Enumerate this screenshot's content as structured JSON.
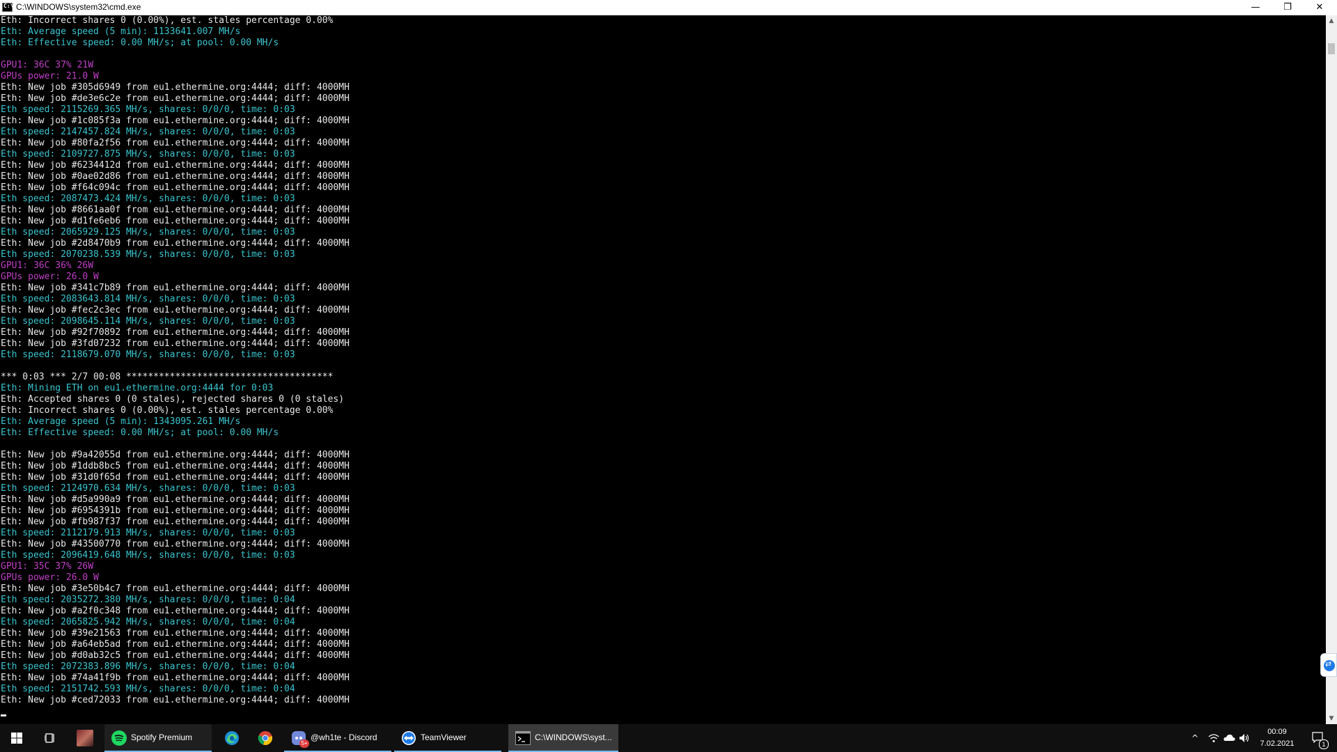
{
  "window": {
    "title": "C:\\WINDOWS\\system32\\cmd.exe",
    "minimize": "—",
    "restore": "❐",
    "close": "✕"
  },
  "colors": {
    "white": "#e8e8e8",
    "cyan": "#39c5cf",
    "magenta": "#c13fc8"
  },
  "console_lines": [
    {
      "text": "Eth: Incorrect shares 0 (0.00%), est. stales percentage 0.00%",
      "color": "white"
    },
    {
      "text": "Eth: Average speed (5 min): 1133641.007 MH/s",
      "color": "cyan"
    },
    {
      "text": "Eth: Effective speed: 0.00 MH/s; at pool: 0.00 MH/s",
      "color": "cyan"
    },
    {
      "text": "",
      "color": "white"
    },
    {
      "text": "GPU1: 36C 37% 21W",
      "color": "magenta"
    },
    {
      "text": "GPUs power: 21.0 W",
      "color": "magenta"
    },
    {
      "text": "Eth: New job #305d6949 from eu1.ethermine.org:4444; diff: 4000MH",
      "color": "white"
    },
    {
      "text": "Eth: New job #de3e6c2e from eu1.ethermine.org:4444; diff: 4000MH",
      "color": "white"
    },
    {
      "text": "Eth speed: 2115269.365 MH/s, shares: 0/0/0, time: 0:03",
      "color": "cyan"
    },
    {
      "text": "Eth: New job #1c085f3a from eu1.ethermine.org:4444; diff: 4000MH",
      "color": "white"
    },
    {
      "text": "Eth speed: 2147457.824 MH/s, shares: 0/0/0, time: 0:03",
      "color": "cyan"
    },
    {
      "text": "Eth: New job #80fa2f56 from eu1.ethermine.org:4444; diff: 4000MH",
      "color": "white"
    },
    {
      "text": "Eth speed: 2109727.875 MH/s, shares: 0/0/0, time: 0:03",
      "color": "cyan"
    },
    {
      "text": "Eth: New job #6234412d from eu1.ethermine.org:4444; diff: 4000MH",
      "color": "white"
    },
    {
      "text": "Eth: New job #0ae02d86 from eu1.ethermine.org:4444; diff: 4000MH",
      "color": "white"
    },
    {
      "text": "Eth: New job #f64c094c from eu1.ethermine.org:4444; diff: 4000MH",
      "color": "white"
    },
    {
      "text": "Eth speed: 2087473.424 MH/s, shares: 0/0/0, time: 0:03",
      "color": "cyan"
    },
    {
      "text": "Eth: New job #8661aa0f from eu1.ethermine.org:4444; diff: 4000MH",
      "color": "white"
    },
    {
      "text": "Eth: New job #d1fe6eb6 from eu1.ethermine.org:4444; diff: 4000MH",
      "color": "white"
    },
    {
      "text": "Eth speed: 2065929.125 MH/s, shares: 0/0/0, time: 0:03",
      "color": "cyan"
    },
    {
      "text": "Eth: New job #2d8470b9 from eu1.ethermine.org:4444; diff: 4000MH",
      "color": "white"
    },
    {
      "text": "Eth speed: 2070238.539 MH/s, shares: 0/0/0, time: 0:03",
      "color": "cyan"
    },
    {
      "text": "GPU1: 36C 36% 26W",
      "color": "magenta"
    },
    {
      "text": "GPUs power: 26.0 W",
      "color": "magenta"
    },
    {
      "text": "Eth: New job #341c7b89 from eu1.ethermine.org:4444; diff: 4000MH",
      "color": "white"
    },
    {
      "text": "Eth speed: 2083643.814 MH/s, shares: 0/0/0, time: 0:03",
      "color": "cyan"
    },
    {
      "text": "Eth: New job #fec2c3ec from eu1.ethermine.org:4444; diff: 4000MH",
      "color": "white"
    },
    {
      "text": "Eth speed: 2098645.114 MH/s, shares: 0/0/0, time: 0:03",
      "color": "cyan"
    },
    {
      "text": "Eth: New job #92f70892 from eu1.ethermine.org:4444; diff: 4000MH",
      "color": "white"
    },
    {
      "text": "Eth: New job #3fd07232 from eu1.ethermine.org:4444; diff: 4000MH",
      "color": "white"
    },
    {
      "text": "Eth speed: 2118679.070 MH/s, shares: 0/0/0, time: 0:03",
      "color": "cyan"
    },
    {
      "text": "",
      "color": "white"
    },
    {
      "text": "*** 0:03 *** 2/7 00:08 **************************************",
      "color": "white"
    },
    {
      "text": "Eth: Mining ETH on eu1.ethermine.org:4444 for 0:03",
      "color": "cyan"
    },
    {
      "text": "Eth: Accepted shares 0 (0 stales), rejected shares 0 (0 stales)",
      "color": "white"
    },
    {
      "text": "Eth: Incorrect shares 0 (0.00%), est. stales percentage 0.00%",
      "color": "white"
    },
    {
      "text": "Eth: Average speed (5 min): 1343095.261 MH/s",
      "color": "cyan"
    },
    {
      "text": "Eth: Effective speed: 0.00 MH/s; at pool: 0.00 MH/s",
      "color": "cyan"
    },
    {
      "text": "",
      "color": "white"
    },
    {
      "text": "Eth: New job #9a42055d from eu1.ethermine.org:4444; diff: 4000MH",
      "color": "white"
    },
    {
      "text": "Eth: New job #1ddb8bc5 from eu1.ethermine.org:4444; diff: 4000MH",
      "color": "white"
    },
    {
      "text": "Eth: New job #31d0f65d from eu1.ethermine.org:4444; diff: 4000MH",
      "color": "white"
    },
    {
      "text": "Eth speed: 2124970.634 MH/s, shares: 0/0/0, time: 0:03",
      "color": "cyan"
    },
    {
      "text": "Eth: New job #d5a990a9 from eu1.ethermine.org:4444; diff: 4000MH",
      "color": "white"
    },
    {
      "text": "Eth: New job #6954391b from eu1.ethermine.org:4444; diff: 4000MH",
      "color": "white"
    },
    {
      "text": "Eth: New job #fb987f37 from eu1.ethermine.org:4444; diff: 4000MH",
      "color": "white"
    },
    {
      "text": "Eth speed: 2112179.913 MH/s, shares: 0/0/0, time: 0:03",
      "color": "cyan"
    },
    {
      "text": "Eth: New job #43500770 from eu1.ethermine.org:4444; diff: 4000MH",
      "color": "white"
    },
    {
      "text": "Eth speed: 2096419.648 MH/s, shares: 0/0/0, time: 0:03",
      "color": "cyan"
    },
    {
      "text": "GPU1: 35C 37% 26W",
      "color": "magenta"
    },
    {
      "text": "GPUs power: 26.0 W",
      "color": "magenta"
    },
    {
      "text": "Eth: New job #3e50b4c7 from eu1.ethermine.org:4444; diff: 4000MH",
      "color": "white"
    },
    {
      "text": "Eth speed: 2035272.380 MH/s, shares: 0/0/0, time: 0:04",
      "color": "cyan"
    },
    {
      "text": "Eth: New job #a2f0c348 from eu1.ethermine.org:4444; diff: 4000MH",
      "color": "white"
    },
    {
      "text": "Eth speed: 2065825.942 MH/s, shares: 0/0/0, time: 0:04",
      "color": "cyan"
    },
    {
      "text": "Eth: New job #39e21563 from eu1.ethermine.org:4444; diff: 4000MH",
      "color": "white"
    },
    {
      "text": "Eth: New job #a64eb5ad from eu1.ethermine.org:4444; diff: 4000MH",
      "color": "white"
    },
    {
      "text": "Eth: New job #d0ab32c5 from eu1.ethermine.org:4444; diff: 4000MH",
      "color": "white"
    },
    {
      "text": "Eth speed: 2072383.896 MH/s, shares: 0/0/0, time: 0:04",
      "color": "cyan"
    },
    {
      "text": "Eth: New job #74a41f9b from eu1.ethermine.org:4444; diff: 4000MH",
      "color": "white"
    },
    {
      "text": "Eth speed: 2151742.593 MH/s, shares: 0/0/0, time: 0:04",
      "color": "cyan"
    },
    {
      "text": "Eth: New job #ced72033 from eu1.ethermine.org:4444; diff: 4000MH",
      "color": "white"
    }
  ],
  "taskbar": {
    "start_icon": "windows-logo",
    "task_view_icon": "task-view",
    "apps": [
      {
        "label": "Spotify Premium",
        "icon": "spotify"
      },
      {
        "label": "",
        "icon": "edge"
      },
      {
        "label": "",
        "icon": "chrome"
      },
      {
        "label": "@wh1te - Discord",
        "icon": "discord",
        "badge": "5+"
      },
      {
        "label": "TeamViewer",
        "icon": "teamviewer"
      },
      {
        "label": "C:\\WINDOWS\\syst...",
        "icon": "cmd"
      }
    ],
    "tray": {
      "time": "00:09",
      "date": "7.02.2021",
      "notification_count": "1"
    }
  }
}
